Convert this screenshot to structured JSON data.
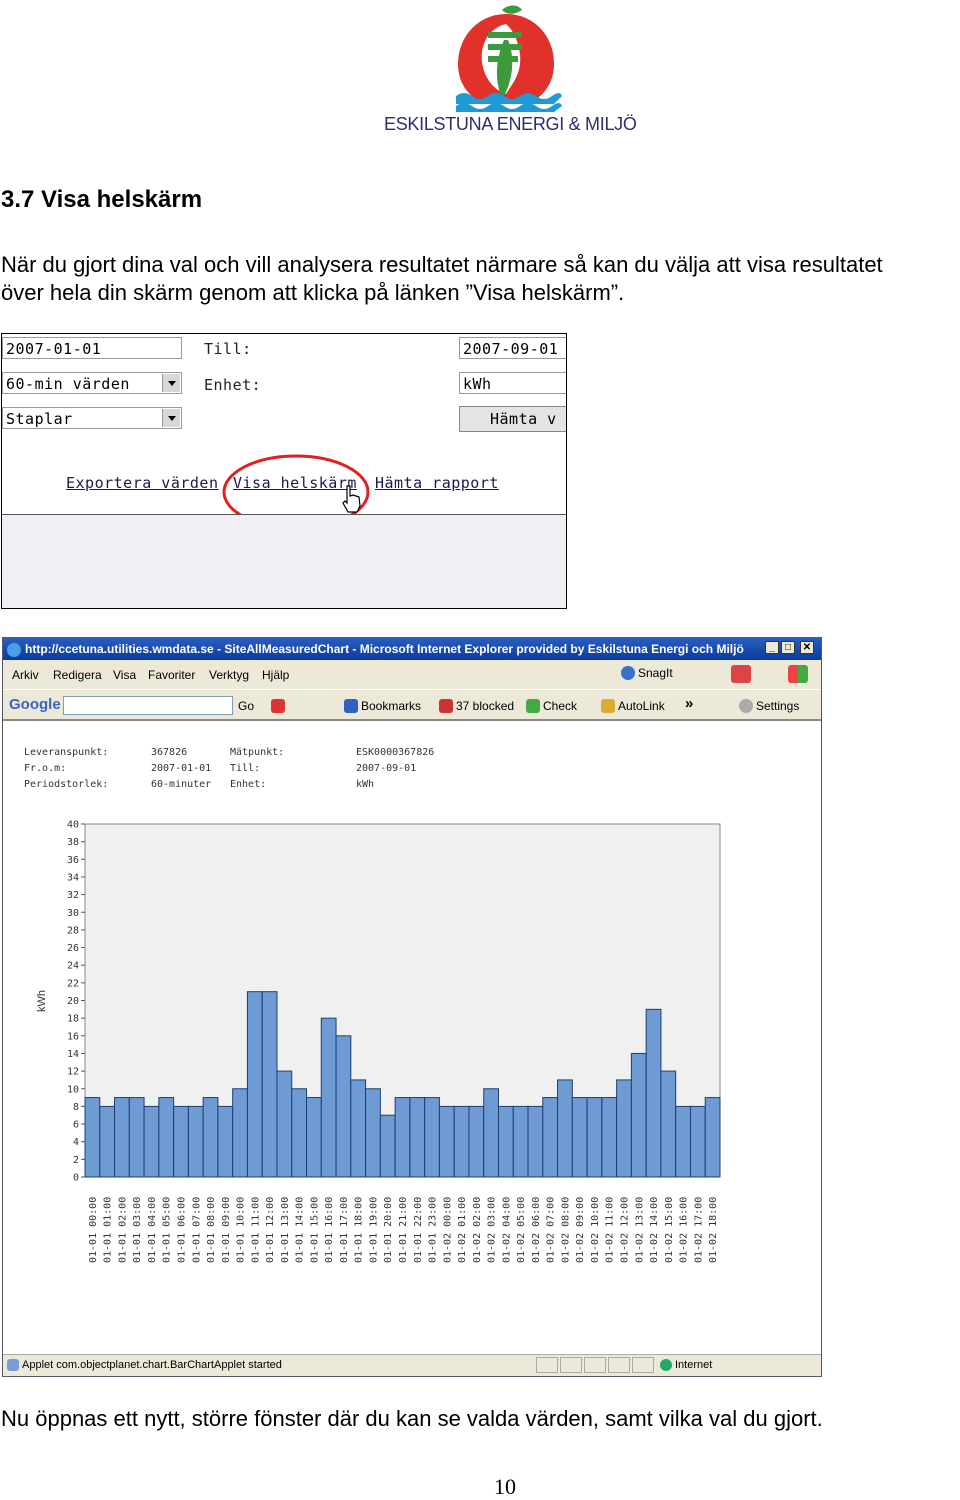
{
  "logo": {
    "text": "ESKILSTUNA ENERGI & MILJÖ",
    "colors": {
      "red": "#e0312b",
      "green": "#3c9a3c",
      "blue": "#1e9ad6"
    }
  },
  "heading": "3.7 Visa helskärm",
  "para1_line1": "När du gjort dina val och vill analysera resultatet närmare så kan du välja att visa resultatet",
  "para1_line2": "över hela din skärm genom att klicka på länken ”Visa helskärm”.",
  "shot1": {
    "from_value": "2007-01-01",
    "till_label": "Till:",
    "till_value": "2007-09-01",
    "resolution_value": "60-min värden",
    "unit_label": "Enhet:",
    "unit_value": "kWh",
    "chart_type_value": "Staplar",
    "fetch_button": "Hämta v",
    "link_export": "Exportera värden",
    "link_fullscreen": "Visa helskärm",
    "link_report": "Hämta rapport"
  },
  "browser": {
    "title": "http://ccetuna.utilities.wmdata.se - SiteAllMeasuredChart - Microsoft Internet Explorer provided by Eskilstuna Energi och Miljö",
    "menu": [
      "Arkiv",
      "Redigera",
      "Visa",
      "Favoriter",
      "Verktyg",
      "Hjälp"
    ],
    "snagit": "SnagIt",
    "toolbar": {
      "google": "Google",
      "go": "Go",
      "bookmarks": "Bookmarks",
      "blocked": "37 blocked",
      "check": "Check",
      "autolink": "AutoLink",
      "more": "»",
      "settings": "Settings"
    },
    "info": {
      "leveranspunkt_label": "Leveranspunkt:",
      "leveranspunkt_value": "367826",
      "matpunkt_label": "Mätpunkt:",
      "matpunkt_value": "ESK0000367826",
      "from_label": "Fr.o.m:",
      "from_value": "2007-01-01",
      "till_label": "Till:",
      "till_value": "2007-09-01",
      "period_label": "Periodstorlek:",
      "period_value": "60-minuter",
      "unit_label": "Enhet:",
      "unit_value": "kWh"
    },
    "status_text": "Applet com.objectplanet.chart.BarChartApplet started",
    "status_zone": "Internet"
  },
  "chart_data": {
    "type": "bar",
    "ylabel": "kWh",
    "ylim": [
      0,
      40
    ],
    "yticks": [
      0,
      2,
      4,
      6,
      8,
      10,
      12,
      14,
      16,
      18,
      20,
      22,
      24,
      26,
      28,
      30,
      32,
      34,
      36,
      38,
      40
    ],
    "categories": [
      "01-01 00:00",
      "01-01 01:00",
      "01-01 02:00",
      "01-01 03:00",
      "01-01 04:00",
      "01-01 05:00",
      "01-01 06:00",
      "01-01 07:00",
      "01-01 08:00",
      "01-01 09:00",
      "01-01 10:00",
      "01-01 11:00",
      "01-01 12:00",
      "01-01 13:00",
      "01-01 14:00",
      "01-01 15:00",
      "01-01 16:00",
      "01-01 17:00",
      "01-01 18:00",
      "01-01 19:00",
      "01-01 20:00",
      "01-01 21:00",
      "01-01 22:00",
      "01-01 23:00",
      "01-02 00:00",
      "01-02 01:00",
      "01-02 02:00",
      "01-02 03:00",
      "01-02 04:00",
      "01-02 05:00",
      "01-02 06:00",
      "01-02 07:00",
      "01-02 08:00",
      "01-02 09:00",
      "01-02 10:00",
      "01-02 11:00",
      "01-02 12:00",
      "01-02 13:00",
      "01-02 14:00",
      "01-02 15:00",
      "01-02 16:00",
      "01-02 17:00",
      "01-02 18:00"
    ],
    "values": [
      9,
      8,
      9,
      9,
      8,
      9,
      8,
      8,
      9,
      8,
      10,
      21,
      21,
      12,
      10,
      9,
      18,
      16,
      11,
      10,
      7,
      9,
      9,
      9,
      8,
      8,
      8,
      10,
      8,
      8,
      8,
      9,
      11,
      9,
      9,
      9,
      11,
      14,
      19,
      12,
      8,
      8,
      9
    ],
    "bar_color": "#6e9bd3",
    "grid": false
  },
  "page_number": "10",
  "closing_text": "Nu öppnas ett nytt, större fönster där du kan se valda värden, samt vilka val du gjort."
}
